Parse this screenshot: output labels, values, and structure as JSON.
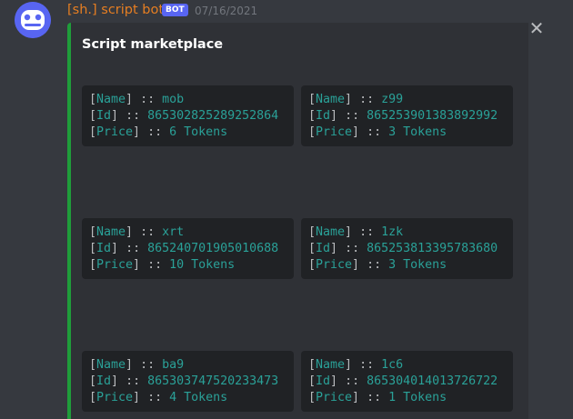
{
  "message": {
    "author": "[sh.] script bot",
    "bot_badge": "BOT",
    "timestamp": "07/16/2021",
    "colors": {
      "author": "#e67e22",
      "badge_bg": "#5865f2",
      "embed_bar": "#1f9d3a",
      "code_text": "#2aa198"
    }
  },
  "embed": {
    "title": "Script marketplace",
    "close_icon": "close-icon",
    "field_labels": {
      "name": "Name",
      "id": "Id",
      "price": "Price"
    },
    "bracket_open": "[",
    "bracket_close": "]",
    "separator": "::",
    "items": [
      {
        "name": "mob",
        "id": "865302825289252864",
        "price": "6 Tokens"
      },
      {
        "name": "z99",
        "id": "865253901383892992",
        "price": "3 Tokens"
      },
      {
        "name": "xrt",
        "id": "865240701905010688",
        "price": "10 Tokens"
      },
      {
        "name": "1zk",
        "id": "865253813395783680",
        "price": "3 Tokens"
      },
      {
        "name": "ba9",
        "id": "865303747520233473",
        "price": "4 Tokens"
      },
      {
        "name": "1c6",
        "id": "865304014013726722",
        "price": "1 Tokens"
      }
    ]
  }
}
